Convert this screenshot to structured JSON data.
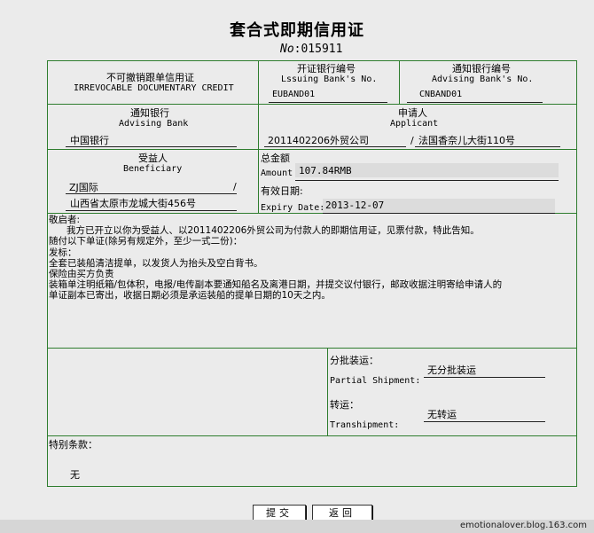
{
  "title": "套合式即期信用证",
  "doc_no_label": "No",
  "doc_no_value": ":015911",
  "credit": {
    "cn": "不可撤销跟单信用证",
    "en": "IRREVOCABLE DOCUMENTARY CREDIT"
  },
  "issuing_bank": {
    "label_cn": "开证银行编号",
    "label_en": "Lssuing Bank's No.",
    "value": "EUBAND01"
  },
  "advising_no": {
    "label_cn": "通知银行编号",
    "label_en": "Advising Bank's No.",
    "value": "CNBAND01"
  },
  "advising_bank": {
    "label_cn": "通知银行",
    "label_en": "Advising Bank",
    "value": "中国银行"
  },
  "applicant": {
    "label_cn": "申请人",
    "label_en": "Applicant",
    "name": "2011402206外贸公司",
    "sep": "/",
    "address": "法国香奈儿大街110号"
  },
  "beneficiary": {
    "label_cn": "受益人",
    "label_en": "Beneficiary",
    "name": "ZJ国际",
    "sep": "/",
    "address": "山西省太原市龙城大街456号"
  },
  "amount": {
    "label_cn": "总金额",
    "label_en": "Amount",
    "value": "107.84RMB"
  },
  "expiry": {
    "label_cn": "有效日期:",
    "label_en": "Expiry Date:",
    "value": "2013-12-07"
  },
  "body": {
    "greeting": "敬启者:",
    "line1": "我方已开立以你为受益人、以2011402206外贸公司为付款人的即期信用证，见票付款，特此告知。",
    "line2": "随付以下单证(除另有规定外，至少一式二份)：",
    "line3": "发标：",
    "line4": "全套已装船清洁提单，以发货人为抬头及空白背书。",
    "line5": "保险由买方负责",
    "line6": "装箱单注明纸箱/包体积，电报/电传副本要通知船名及离港日期，并提交议付银行，邮政收据注明寄给申请人的",
    "line7": "单证副本已寄出，收据日期必须是承运装船的提单日期的10天之内。"
  },
  "partial": {
    "label_cn": "分批装运：",
    "label_en": "Partial Shipment:",
    "value": "无分批装运"
  },
  "transship": {
    "label_cn": "转运：",
    "label_en": "Transhipment:",
    "value": "无转运"
  },
  "special": {
    "label": "特别条款：",
    "value": "无"
  },
  "buttons": {
    "submit": "提交",
    "back": "返回"
  },
  "footer": "emotionalover.blog.163.com"
}
